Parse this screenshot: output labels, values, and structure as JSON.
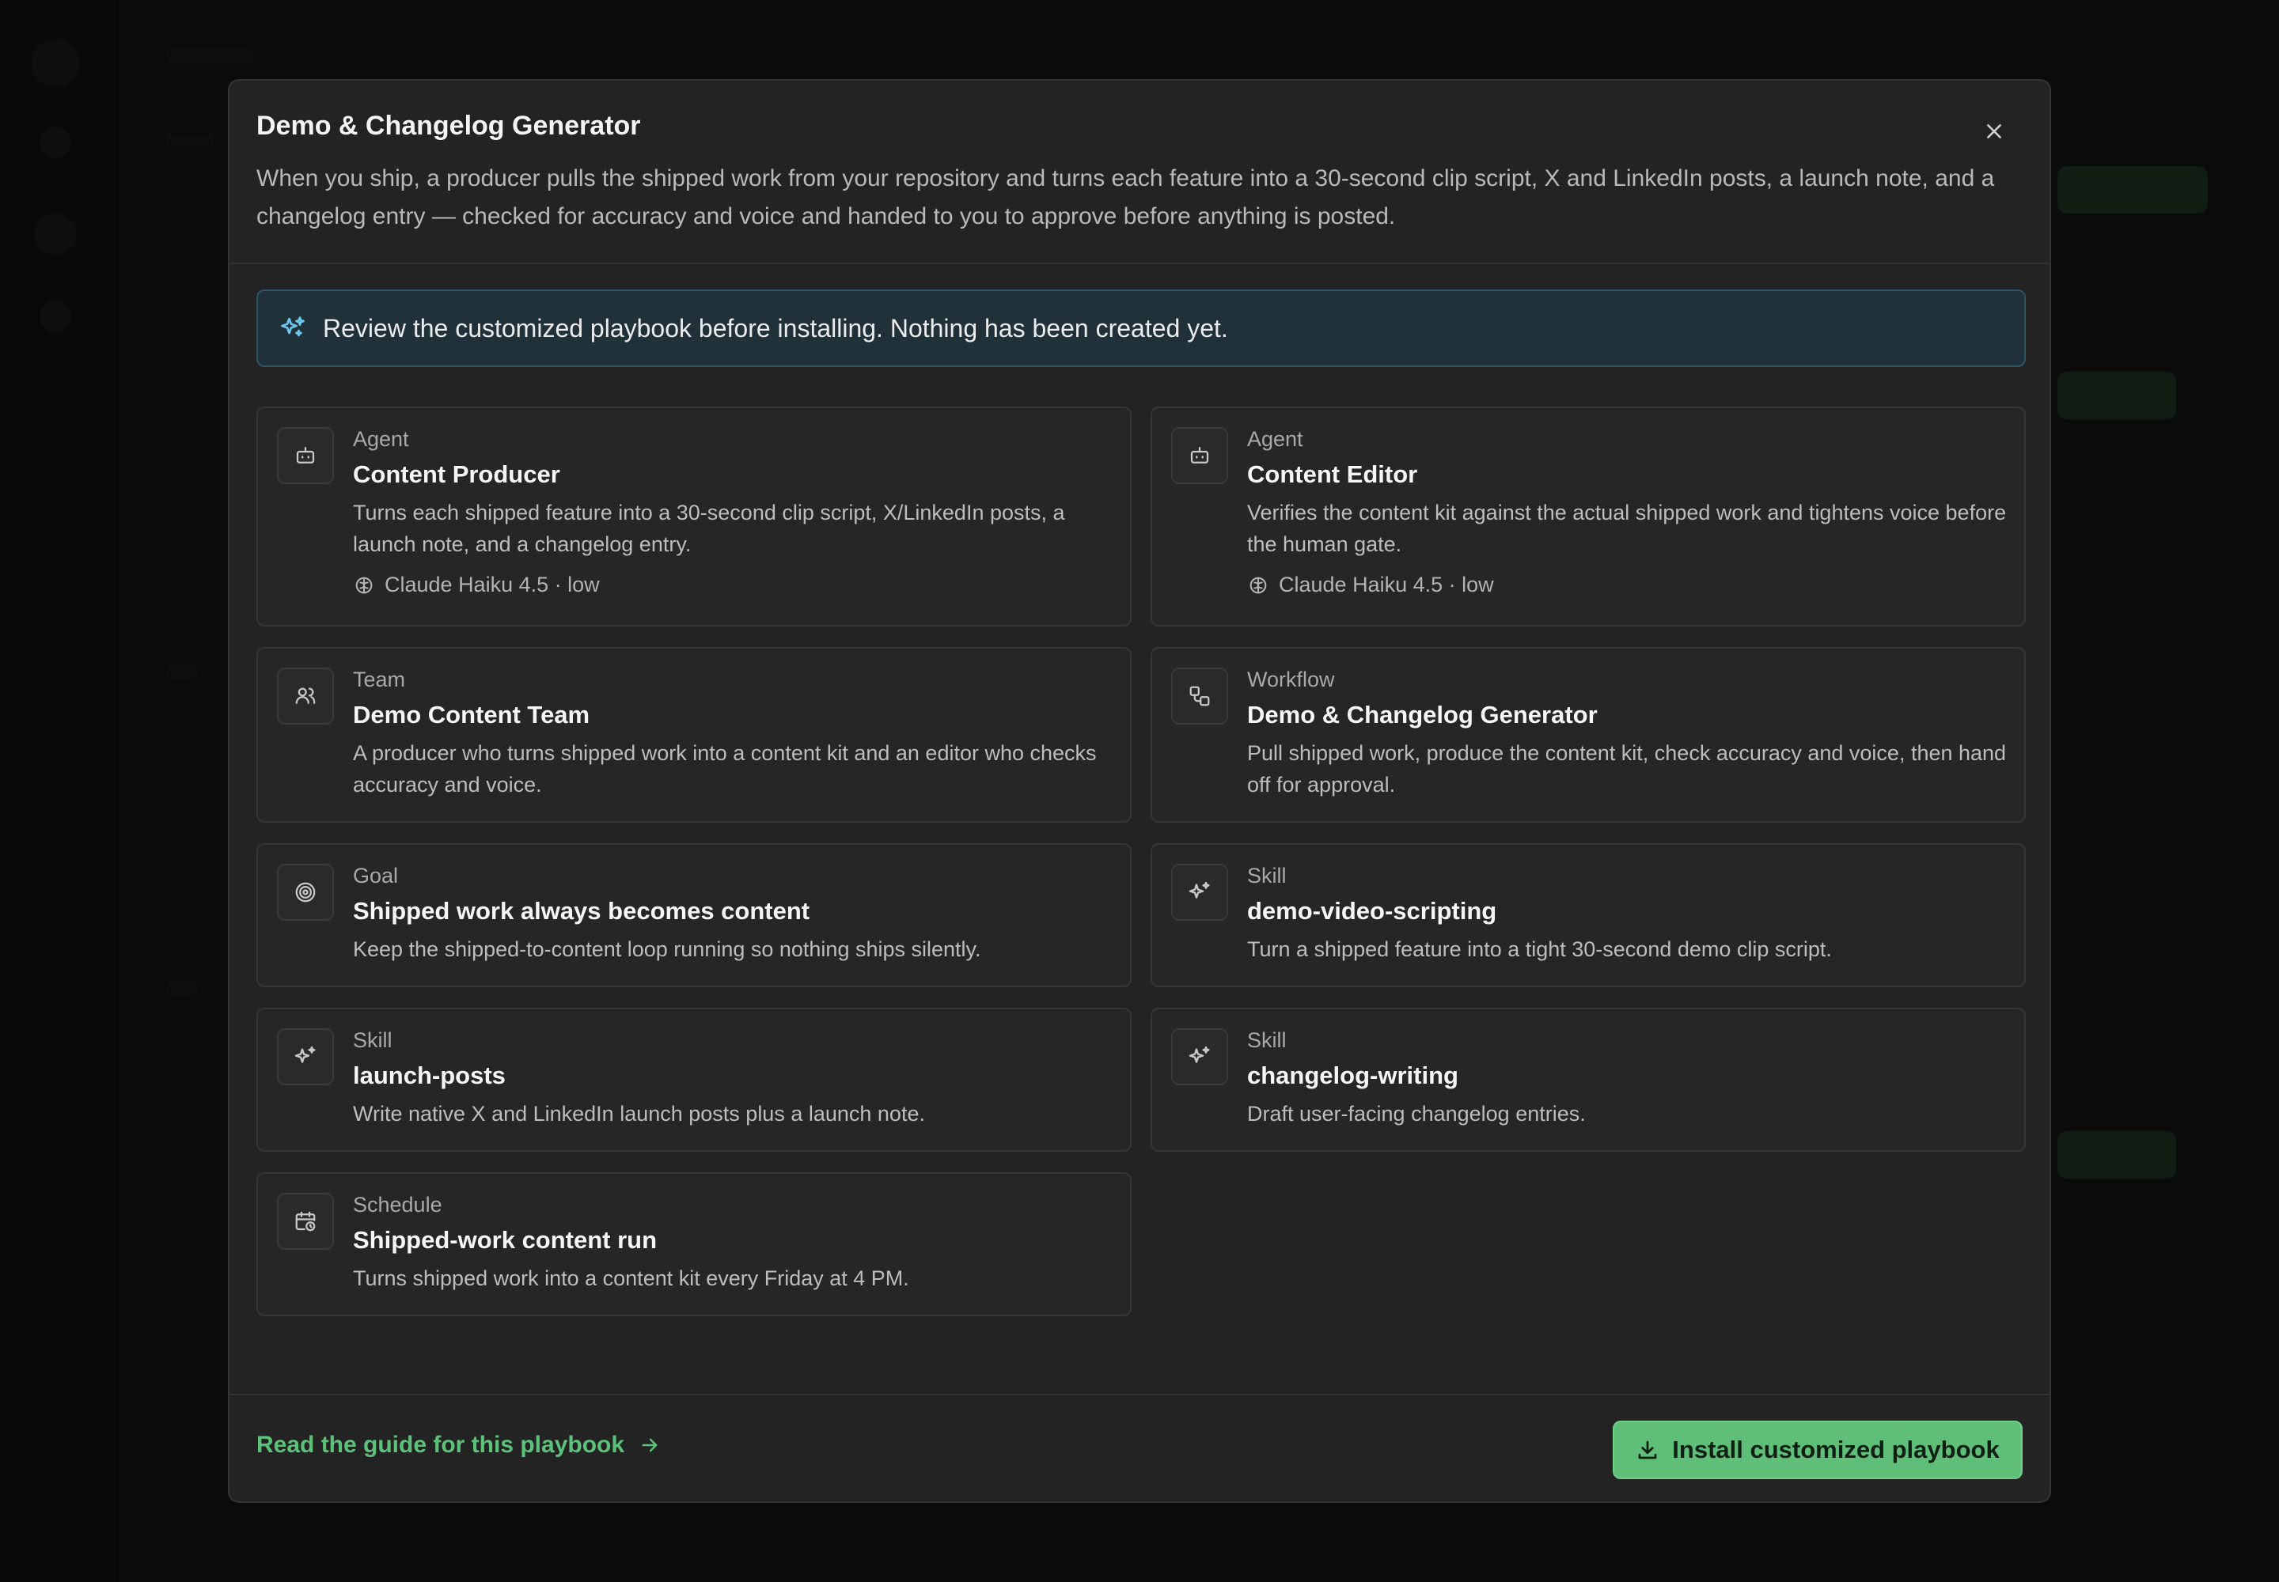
{
  "modal": {
    "title": "Demo & Changelog Generator",
    "description": "When you ship, a producer pulls the shipped work from your repository and turns each feature into a 30-second clip script, X and LinkedIn posts, a launch note, and a changelog entry — checked for accuracy and voice and handed to you to approve before anything is posted."
  },
  "banner": {
    "text": "Review the customized playbook before installing. Nothing has been created yet.",
    "icon": "sparkles-icon"
  },
  "cards": [
    {
      "kind": "Agent",
      "name": "Content Producer",
      "text": "Turns each shipped feature into a 30-second clip script, X/LinkedIn posts, a launch note, and a changelog entry.",
      "model": "Claude Haiku 4.5 · low",
      "icon": "robot-icon"
    },
    {
      "kind": "Agent",
      "name": "Content Editor",
      "text": "Verifies the content kit against the actual shipped work and tightens voice before the human gate.",
      "model": "Claude Haiku 4.5 · low",
      "icon": "robot-icon"
    },
    {
      "kind": "Team",
      "name": "Demo Content Team",
      "text": "A producer who turns shipped work into a content kit and an editor who checks accuracy and voice.",
      "icon": "users-icon"
    },
    {
      "kind": "Workflow",
      "name": "Demo & Changelog Generator",
      "text": "Pull shipped work, produce the content kit, check accuracy and voice, then hand off for approval.",
      "icon": "workflow-icon"
    },
    {
      "kind": "Goal",
      "name": "Shipped work always becomes content",
      "text": "Keep the shipped-to-content loop running so nothing ships silently.",
      "icon": "target-icon"
    },
    {
      "kind": "Skill",
      "name": "demo-video-scripting",
      "text": "Turn a shipped feature into a tight 30-second demo clip script.",
      "icon": "sparkles-icon"
    },
    {
      "kind": "Skill",
      "name": "launch-posts",
      "text": "Write native X and LinkedIn launch posts plus a launch note.",
      "icon": "sparkles-icon"
    },
    {
      "kind": "Skill",
      "name": "changelog-writing",
      "text": "Draft user-facing changelog entries.",
      "icon": "sparkles-icon"
    },
    {
      "kind": "Schedule",
      "name": "Shipped-work content run",
      "text": "Turns shipped work into a content kit every Friday at 4 PM.",
      "icon": "calendar-clock-icon"
    }
  ],
  "footer": {
    "guide_link": "Read the guide for this playbook",
    "install_label": "Install customized playbook"
  },
  "colors": {
    "accent_green": "#5fbf78",
    "banner_bg": "#213139",
    "modal_bg": "#232323"
  }
}
